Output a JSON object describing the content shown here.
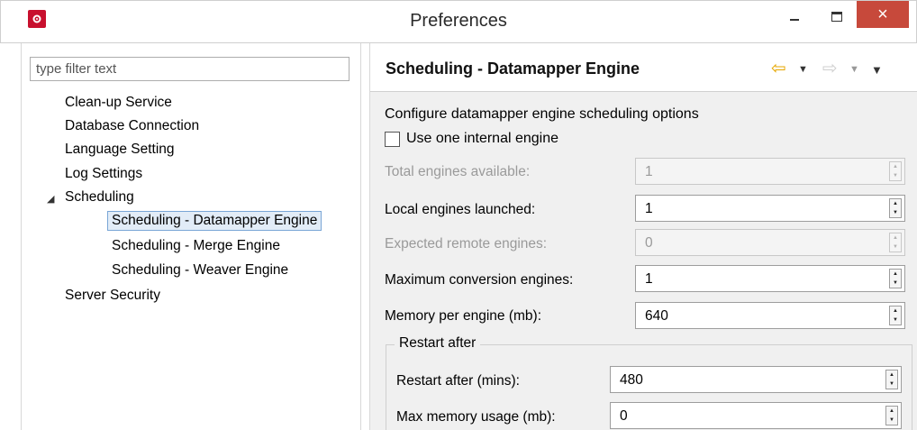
{
  "window": {
    "title": "Preferences",
    "close_glyph": "×",
    "icons": {
      "app": "app-gear-icon",
      "minimize": "minimize-icon",
      "maximize": "maximize-icon",
      "close": "close-icon"
    },
    "colors": {
      "app_icon": "#c8102e",
      "close_button": "#c7493b",
      "selection": "#e2ecf7"
    }
  },
  "sidebar": {
    "filter_placeholder": "type filter text",
    "items": [
      {
        "label": "Clean-up Service"
      },
      {
        "label": "Database Connection"
      },
      {
        "label": "Language Setting"
      },
      {
        "label": "Log Settings"
      },
      {
        "label": "Scheduling",
        "expanded": true
      },
      {
        "label": "Scheduling - Datamapper Engine",
        "selected": true
      },
      {
        "label": "Scheduling - Merge Engine"
      },
      {
        "label": "Scheduling - Weaver Engine"
      },
      {
        "label": "Server Security"
      }
    ]
  },
  "page": {
    "title": "Scheduling - Datamapper Engine",
    "description": "Configure datamapper engine scheduling options",
    "use_internal_engine": {
      "label": "Use one internal engine",
      "checked": false
    },
    "fields": [
      {
        "label": "Total engines available:",
        "value": "1",
        "enabled": false
      },
      {
        "label": "Local engines launched:",
        "value": "1",
        "enabled": true
      },
      {
        "label": "Expected remote engines:",
        "value": "0",
        "enabled": false
      },
      {
        "label": "Maximum conversion engines:",
        "value": "1",
        "enabled": true
      },
      {
        "label": "Memory per engine (mb):",
        "value": "640",
        "enabled": true
      }
    ],
    "restart_group": {
      "title": "Restart after",
      "fields": [
        {
          "label": "Restart after (mins):",
          "value": "480"
        },
        {
          "label": "Max memory usage (mb):",
          "value": "0"
        }
      ]
    }
  }
}
